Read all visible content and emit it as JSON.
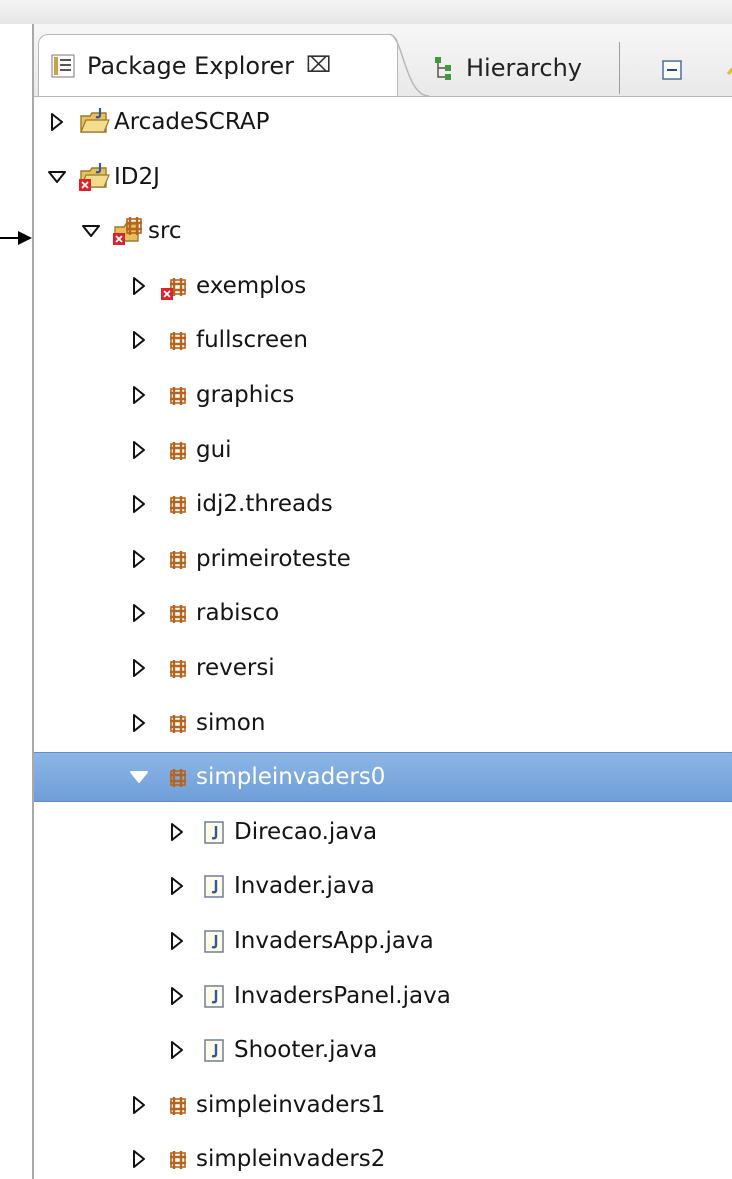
{
  "tabs": {
    "package_explorer": {
      "label": "Package Explorer",
      "close": "⌧"
    },
    "hierarchy": {
      "label": "Hierarchy"
    }
  },
  "tree": [
    {
      "label": "ArcadeSCRAP",
      "kind": "project",
      "expanded": false,
      "level": 0
    },
    {
      "label": "ID2J",
      "kind": "project-error",
      "expanded": true,
      "level": 0
    },
    {
      "label": "src",
      "kind": "srcfolder-error",
      "expanded": true,
      "level": 1
    },
    {
      "label": "exemplos",
      "kind": "package-error",
      "expanded": false,
      "level": 2
    },
    {
      "label": "fullscreen",
      "kind": "package",
      "expanded": false,
      "level": 2
    },
    {
      "label": "graphics",
      "kind": "package",
      "expanded": false,
      "level": 2
    },
    {
      "label": "gui",
      "kind": "package",
      "expanded": false,
      "level": 2
    },
    {
      "label": "idj2.threads",
      "kind": "package",
      "expanded": false,
      "level": 2
    },
    {
      "label": "primeiroteste",
      "kind": "package",
      "expanded": false,
      "level": 2
    },
    {
      "label": "rabisco",
      "kind": "package",
      "expanded": false,
      "level": 2
    },
    {
      "label": "reversi",
      "kind": "package",
      "expanded": false,
      "level": 2
    },
    {
      "label": "simon",
      "kind": "package",
      "expanded": false,
      "level": 2
    },
    {
      "label": "simpleinvaders0",
      "kind": "package",
      "expanded": true,
      "level": 2,
      "selected": true
    },
    {
      "label": "Direcao.java",
      "kind": "java",
      "expanded": false,
      "level": 3
    },
    {
      "label": "Invader.java",
      "kind": "java",
      "expanded": false,
      "level": 3
    },
    {
      "label": "InvadersApp.java",
      "kind": "java",
      "expanded": false,
      "level": 3
    },
    {
      "label": "InvadersPanel.java",
      "kind": "java",
      "expanded": false,
      "level": 3
    },
    {
      "label": "Shooter.java",
      "kind": "java",
      "expanded": false,
      "level": 3
    },
    {
      "label": "simpleinvaders1",
      "kind": "package",
      "expanded": false,
      "level": 2
    },
    {
      "label": "simpleinvaders2",
      "kind": "package",
      "expanded": false,
      "level": 2
    }
  ],
  "colors": {
    "selection": "#7aa7de",
    "package": "#b5651d",
    "error": "#d9232d",
    "folder": "#e8c15a"
  }
}
